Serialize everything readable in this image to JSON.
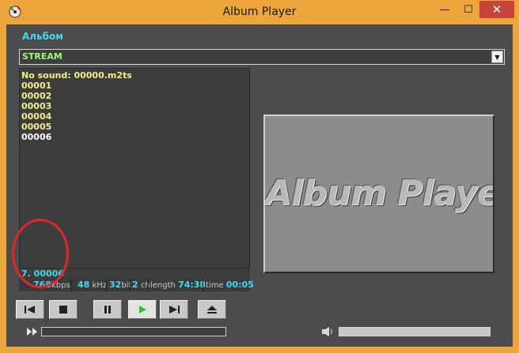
{
  "window": {
    "title": "Album Player",
    "minimize_glyph": "—",
    "maximize_glyph": "☐",
    "close_glyph": "✕"
  },
  "album": {
    "label": "Альбом",
    "selected": "STREAM"
  },
  "playlist": {
    "items": [
      {
        "label": "No sound: 00000.m2ts"
      },
      {
        "label": "00001"
      },
      {
        "label": "00002"
      },
      {
        "label": "00003"
      },
      {
        "label": "00004"
      },
      {
        "label": "00005"
      },
      {
        "label": "00006",
        "current": true
      }
    ]
  },
  "now_playing": {
    "text": "7.  00006"
  },
  "stats": {
    "bitrate": "768",
    "bitrate_unit": "kbps",
    "samplerate": "48",
    "samplerate_unit": "kHz",
    "bits": "32",
    "bits_unit": "bit",
    "channels": "2",
    "channels_unit": "ch",
    "length_label": "length",
    "length": "74:38",
    "time_label": "time",
    "time": "00:05"
  },
  "logo": {
    "text": "Album Player"
  },
  "controls": {
    "icons": [
      "previous-icon",
      "stop-icon",
      "pause-icon",
      "play-icon",
      "next-icon",
      "eject-icon"
    ]
  },
  "colors": {
    "titlebar": "#eba53a",
    "accent_cyan": "#44d7f5",
    "stream_green": "#9bfa7a",
    "track_yellow": "#f2f08a",
    "play_green": "#2fc22f",
    "annotation_red": "#e0262b"
  },
  "seek": {
    "progress": 0
  },
  "volume": {
    "level": 0.0
  }
}
